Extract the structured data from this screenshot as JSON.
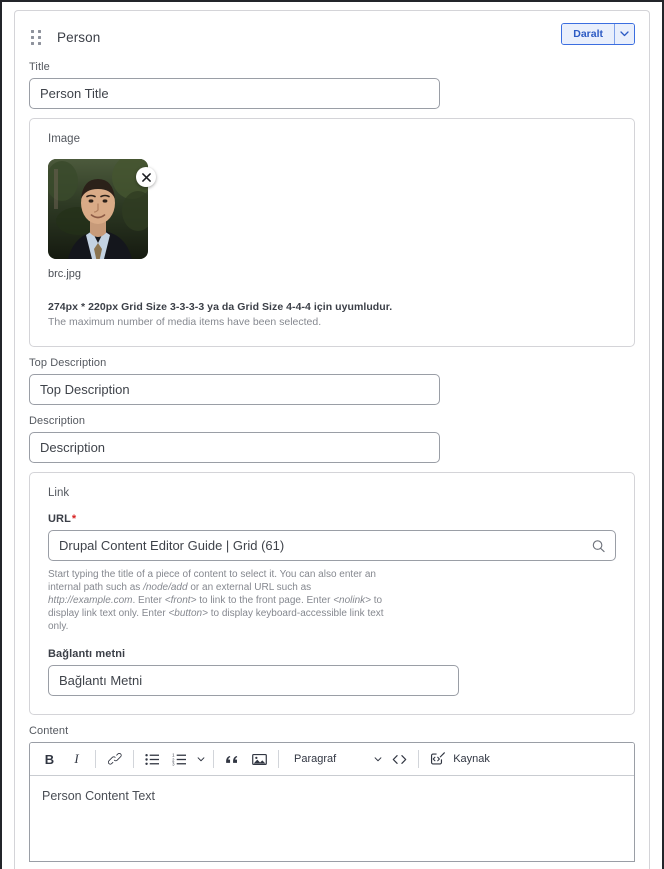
{
  "paragraph": {
    "type_label": "Person",
    "drag_handle_icon": "drag-dots-icon",
    "collapse_button": "Daralt",
    "collapse_caret_icon": "chevron-down-icon"
  },
  "title_field": {
    "label": "Title",
    "value": "Person Title",
    "placeholder": "Person Title"
  },
  "image_field": {
    "label": "Image",
    "media": {
      "file_name": "brc.jpg",
      "remove_icon": "close-icon",
      "alt": "portrait-photo"
    },
    "note_strong": "274px * 220px Grid Size 3-3-3-3 ya da Grid Size 4-4-4 için uyumludur.",
    "note_dim": "The maximum number of media items have been selected."
  },
  "top_description_field": {
    "label": "Top Description",
    "value": "Top Description",
    "placeholder": "Top Description"
  },
  "description_field": {
    "label": "Description",
    "value": "Description",
    "placeholder": "Description"
  },
  "link_field": {
    "label": "Link",
    "url": {
      "label": "URL",
      "required_marker": "*",
      "value": "Drupal Content Editor Guide | Grid (61)",
      "placeholder": "Drupal Content Editor Guide | Grid (61)",
      "search_icon": "search-icon",
      "help_parts": {
        "p1": "Start typing the title of a piece of content to select it. You can also enter an internal path such as ",
        "i1": "/node/add",
        "p2": " or an external URL such as ",
        "i2": "http://example.com",
        "p3": ". Enter ",
        "i3": "<front>",
        "p4": " to link to the front page. Enter ",
        "i4": "<nolink>",
        "p5": " to display link text only. Enter ",
        "i5": "<button>",
        "p6": " to display keyboard-accessible link text only."
      }
    },
    "link_text": {
      "label": "Bağlantı metni",
      "value": "Bağlantı Metni",
      "placeholder": "Bağlantı Metni"
    }
  },
  "content_field": {
    "label": "Content",
    "body_text": "Person Content Text",
    "toolbar": {
      "bold": "B",
      "bold_icon": "bold-icon",
      "italic": "I",
      "italic_icon": "italic-icon",
      "link_icon": "link-icon",
      "bulleted_list_icon": "bulleted-list-icon",
      "numbered_list_icon": "numbered-list-icon",
      "list-caret_icon": "chevron-down-icon",
      "blockquote_icon": "blockquote-icon",
      "image_icon": "image-icon",
      "paragraph_format": "Paragraf",
      "format_caret_icon": "chevron-down-icon",
      "code_icon": "source-code-icon",
      "source_label": "Kaynak",
      "source_icon": "source-editing-icon"
    }
  },
  "colors": {
    "accent": "#2d5bc4",
    "accent_bg": "#e9effc",
    "border": "#d4d4d8",
    "input_border": "#9a9ea6",
    "required": "#d72222",
    "text": "#3b3f47",
    "muted": "#85888f"
  }
}
